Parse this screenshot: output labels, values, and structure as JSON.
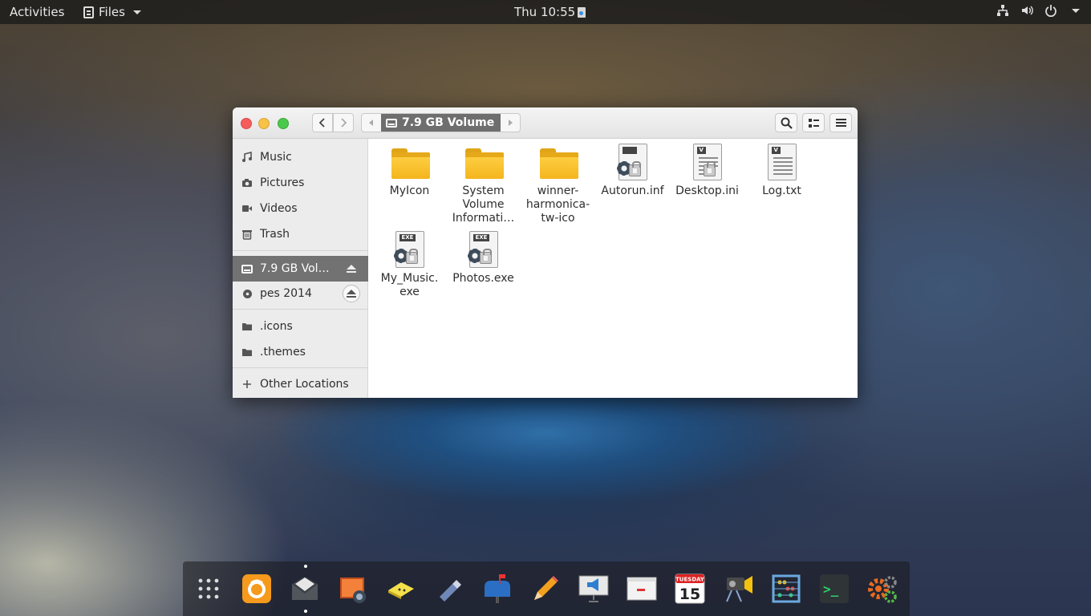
{
  "topbar": {
    "activities": "Activities",
    "app_menu": "Files",
    "clock": "Thu 10:55",
    "tray_icons": [
      "network-icon",
      "volume-icon",
      "power-icon",
      "chevron-down-icon"
    ]
  },
  "window": {
    "path": "7.9 GB Volume",
    "sidebar": {
      "places": [
        {
          "label": "Music",
          "icon": "music-note-icon"
        },
        {
          "label": "Pictures",
          "icon": "camera-icon"
        },
        {
          "label": "Videos",
          "icon": "video-icon"
        },
        {
          "label": "Trash",
          "icon": "trash-icon"
        }
      ],
      "devices": [
        {
          "label": "7.9 GB Vol…",
          "icon": "drive-icon",
          "active": true
        },
        {
          "label": "pes 2014",
          "icon": "disc-icon",
          "active": false
        }
      ],
      "bookmarks": [
        {
          "label": ".icons",
          "icon": "folder-icon"
        },
        {
          "label": ".themes",
          "icon": "folder-icon"
        }
      ],
      "other": {
        "label": "Other Locations",
        "icon": "plus-icon"
      }
    },
    "files": [
      {
        "name_lines": [
          "MyIcon"
        ],
        "kind": "folder"
      },
      {
        "name_lines": [
          "System",
          "Volume",
          "Informati…"
        ],
        "kind": "folder"
      },
      {
        "name_lines": [
          "winner-",
          "harmonica-",
          "tw-ico"
        ],
        "kind": "folder"
      },
      {
        "name_lines": [
          "Autorun.inf"
        ],
        "kind": "settings-doc"
      },
      {
        "name_lines": [
          "Desktop.ini"
        ],
        "kind": "text-locked",
        "badge": "V"
      },
      {
        "name_lines": [
          "Log.txt"
        ],
        "kind": "text",
        "badge": "V"
      },
      {
        "name_lines": [
          "My_Music.",
          "exe"
        ],
        "kind": "exe",
        "badge": "EXE"
      },
      {
        "name_lines": [
          "Photos.exe"
        ],
        "kind": "exe",
        "badge": "EXE"
      }
    ]
  },
  "dock": {
    "apps": [
      "app-grid-icon",
      "firefox-icon",
      "mail-icon",
      "image-viewer-icon",
      "sticky-notes-icon",
      "usb-drive-icon",
      "mailbox-icon",
      "pencil-icon",
      "presentation-icon",
      "document-viewer-icon",
      "calendar-icon",
      "video-editor-icon",
      "abacus-icon",
      "terminal-icon",
      "settings-icon"
    ],
    "calendar_day": "15",
    "calendar_weekday": "TUESDAY",
    "terminal_prompt": ">_"
  }
}
